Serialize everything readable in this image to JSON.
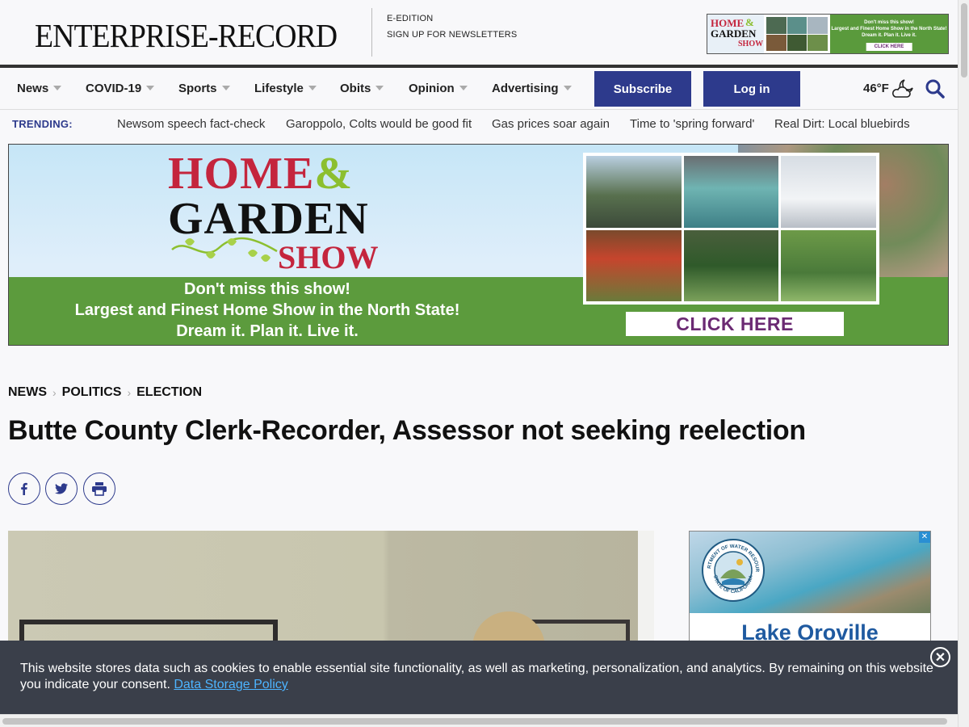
{
  "header": {
    "logo_text": "ENTERPRISE-RECORD",
    "links": [
      "E-EDITION",
      "SIGN UP FOR NEWSLETTERS"
    ],
    "ad": {
      "home": "HOME",
      "amp": "&",
      "garden": "GARDEN",
      "show": "SHOW",
      "line1": "Don't miss this show!",
      "line2": "Largest and Finest Home Show in the North State!",
      "line3": "Dream it. Plan it. Live it.",
      "cta": "CLICK HERE"
    }
  },
  "nav": {
    "items": [
      "News",
      "COVID-19",
      "Sports",
      "Lifestyle",
      "Obits",
      "Opinion",
      "Advertising"
    ],
    "subscribe": "Subscribe",
    "login": "Log in",
    "temperature": "46°F"
  },
  "trending": {
    "label": "TRENDING:",
    "items": [
      "Newsom speech fact-check",
      "Garoppolo, Colts would be good fit",
      "Gas prices soar again",
      "Time to 'spring forward'",
      "Real Dirt: Local bluebirds"
    ]
  },
  "banner_ad": {
    "home": "HOME",
    "amp": "&",
    "garden": "GARDEN",
    "show": "SHOW",
    "line1": "Don't miss this show!",
    "line2": "Largest and Finest Home Show in the North State!",
    "line3": "Dream it. Plan it. Live it.",
    "cta": "CLICK HERE"
  },
  "article": {
    "breadcrumb": [
      "NEWS",
      "POLITICS",
      "ELECTION"
    ],
    "headline": "Butte County Clerk-Recorder, Assessor not seeking reelection"
  },
  "side_ad": {
    "seal_top": "DEPARTMENT OF WATER RESOURCES",
    "seal_bottom": "STATE OF CALIFORNIA",
    "title": "Lake Oroville",
    "adchoice": "✕"
  },
  "cookie": {
    "message": "This website stores data such as cookies to enable essential site functionality, as well as marketing, personalization, and analytics. By remaining on this website you indicate your consent.",
    "link": "Data Storage Policy",
    "close": "✕"
  },
  "colors": {
    "brand_navy": "#2d3a8c",
    "ad_green": "#5c9b3d",
    "ad_red": "#c4253d",
    "cookie_bg": "#3a3f4a",
    "cookie_link": "#4db4ff"
  },
  "icons": [
    "facebook-icon",
    "twitter-icon",
    "print-icon",
    "search-icon",
    "partly-cloudy-night-icon",
    "close-icon"
  ]
}
